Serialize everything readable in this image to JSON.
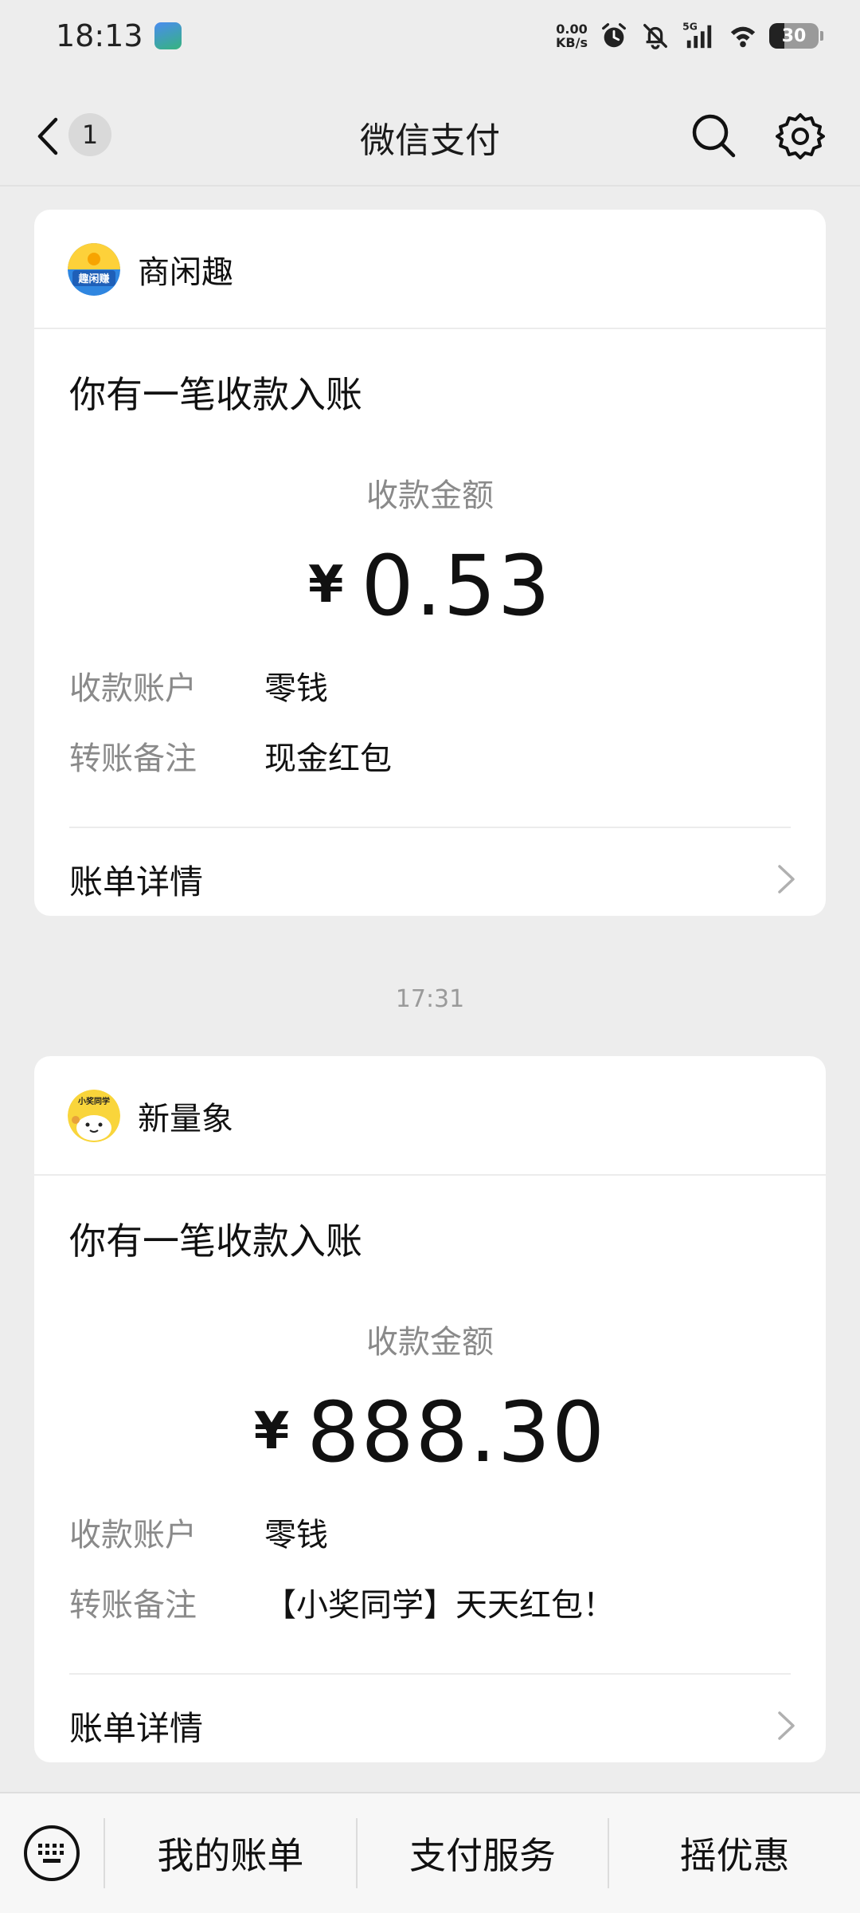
{
  "status_bar": {
    "time": "18:13",
    "net_speed_value": "0.00",
    "net_speed_unit": "KB/s",
    "network": "5G",
    "battery": "30",
    "battery_level_percent": 30
  },
  "nav": {
    "back_badge": "1",
    "title": "微信支付"
  },
  "cards": [
    {
      "merchant": "商闲趣",
      "avatar_text": "趣闲赚",
      "headline": "你有一笔收款入账",
      "amount_label": "收款金额",
      "currency": "¥",
      "amount": "0.53",
      "account_label": "收款账户",
      "account_value": "零钱",
      "note_label": "转账备注",
      "note_value": "现金红包",
      "details_label": "账单详情"
    },
    {
      "merchant": "新量象",
      "avatar_text": "小奖同学",
      "headline": "你有一笔收款入账",
      "amount_label": "收款金额",
      "currency": "¥",
      "amount": "888.30",
      "account_label": "收款账户",
      "account_value": "零钱",
      "note_label": "转账备注",
      "note_value": "【小奖同学】天天红包！",
      "details_label": "账单详情"
    }
  ],
  "timestamp": "17:31",
  "bottom_bar": {
    "items": [
      "我的账单",
      "支付服务",
      "摇优惠"
    ]
  },
  "colors": {
    "background": "#ededed",
    "card": "#ffffff",
    "muted_text": "#8a8a8a"
  }
}
